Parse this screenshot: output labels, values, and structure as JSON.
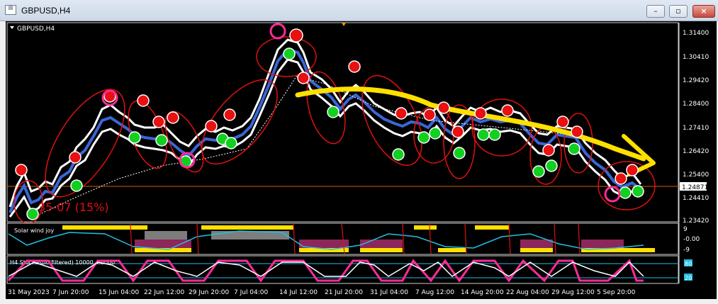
{
  "window": {
    "title": "GBPUSD,H4",
    "icon": "chart-icon",
    "buttons": {
      "minimize": "–",
      "restore": "▫",
      "close": "×"
    }
  },
  "chart": {
    "symbol_label": "GBPUSD,H4",
    "current_price": "1.24871",
    "price_ticks": [
      "1.31400",
      "1.30410",
      "1.29420",
      "1.28400",
      "1.27410",
      "1.26420",
      "1.25400",
      "1.24410",
      "1.23420"
    ],
    "date_ticks": [
      "31 May 2023",
      "7 Jun 20:00",
      "15 Jun 04:00",
      "22 Jun 12:00",
      "29 Jun 20:00",
      "7 Jul 04:00",
      "14 Jul 12:00",
      "21 Jul 20:00",
      "31 Jul 04:00",
      "7 Aug 12:00",
      "14 Aug 20:00",
      "22 Aug 04:00",
      "29 Aug 12:00",
      "5 Sep 20:00"
    ],
    "annotation": "35-07 (15%)",
    "colors": {
      "background": "#000000",
      "candles": "#3a66d6",
      "envelope": "#ffffff",
      "circles": "#e01010",
      "trend": "#ffe000",
      "price_line": "#e06000",
      "buy_signal": "#12d020",
      "sell_signal": "#e81010",
      "pink": "#ff2a9a"
    }
  },
  "indicator1": {
    "label": "Solar wind joy",
    "levels": [
      "9",
      "-0.00",
      "-9"
    ]
  },
  "indicator2": {
    "label": "H4 Stochastic(filtered) 10000 4.0000",
    "levels": [
      "80",
      "20"
    ]
  }
}
